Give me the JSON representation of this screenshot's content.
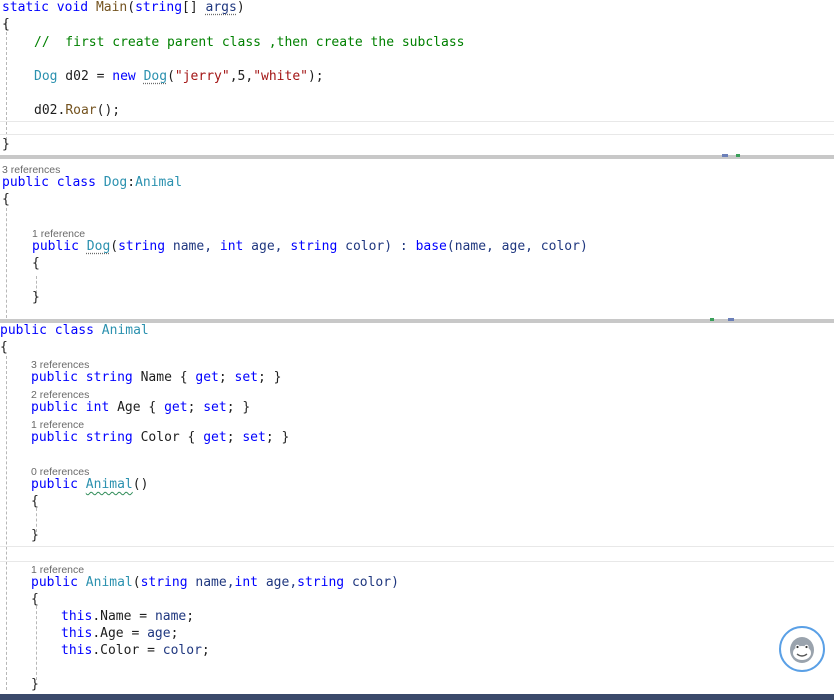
{
  "main_block": {
    "signature": {
      "kw1": "static",
      "kw2": "void",
      "name": "Main",
      "p1": "(",
      "type": "string",
      "p2": "[] ",
      "arg": "args",
      "p3": ")"
    },
    "open_brace": "{",
    "comment": "//  first create parent class ,then create the subclass",
    "decl": {
      "type": "Dog",
      "var": " d02 = ",
      "kw": "new",
      "sp": " ",
      "ctor": "Dog",
      "p1": "(",
      "s1": "\"jerry\"",
      "c1": ",5,",
      "s2": "\"white\"",
      "p2": ");"
    },
    "call": {
      "obj": "d02.",
      "method": "Roar",
      "rest": "();"
    },
    "close_brace": "}"
  },
  "dog_block": {
    "refs": "3 references",
    "decl": {
      "kw1": "public",
      "kw2": "class",
      "name": "Dog",
      "colon": ":",
      "base": "Animal"
    },
    "open_brace": "{",
    "ctor_refs": "1 reference",
    "ctor": {
      "kw": "public",
      "name": "Dog",
      "p1": "(",
      "t1": "string",
      "n1": " name, ",
      "t2": "int",
      "n2": " age, ",
      "t3": "string",
      "n3": " color) : ",
      "base": "base",
      "args": "(name, age, color)"
    },
    "ctor_open": "{",
    "ctor_close": "}"
  },
  "animal_block": {
    "decl": {
      "kw1": "public",
      "kw2": "class",
      "name": "Animal"
    },
    "open_brace": "{",
    "props": [
      {
        "refs": "3 references",
        "kw": "public",
        "type": "string",
        "name": " Name { ",
        "get": "get",
        "semi1": "; ",
        "set": "set",
        "end": "; }"
      },
      {
        "refs": "2 references",
        "kw": "public",
        "type": "int",
        "name": " Age { ",
        "get": "get",
        "semi1": "; ",
        "set": "set",
        "end": "; }"
      },
      {
        "refs": "1 reference",
        "kw": "public",
        "type": "string",
        "name": " Color { ",
        "get": "get",
        "semi1": "; ",
        "set": "set",
        "end": "; }"
      }
    ],
    "ctor0_refs": "0 references",
    "ctor0": {
      "kw": "public",
      "name": "Animal",
      "rest": "()"
    },
    "ctor0_open": "{",
    "ctor0_close": "}",
    "ctor1_refs": "1 reference",
    "ctor1": {
      "kw": "public",
      "name": "Animal",
      "p1": "(",
      "t1": "string",
      "n1": " name,",
      "t2": "int",
      "n2": " age,",
      "t3": "string",
      "n3": " color)"
    },
    "ctor1_open": "{",
    "assign": [
      {
        "this": "this",
        "rest": ".Name = ",
        "val": "name",
        "end": ";"
      },
      {
        "this": "this",
        "rest": ".Age = ",
        "val": "age",
        "end": ";"
      },
      {
        "this": "this",
        "rest": ".Color = ",
        "val": "color",
        "end": ";"
      }
    ],
    "ctor1_close": "}"
  },
  "avatar_icon": "assistant-avatar-icon"
}
